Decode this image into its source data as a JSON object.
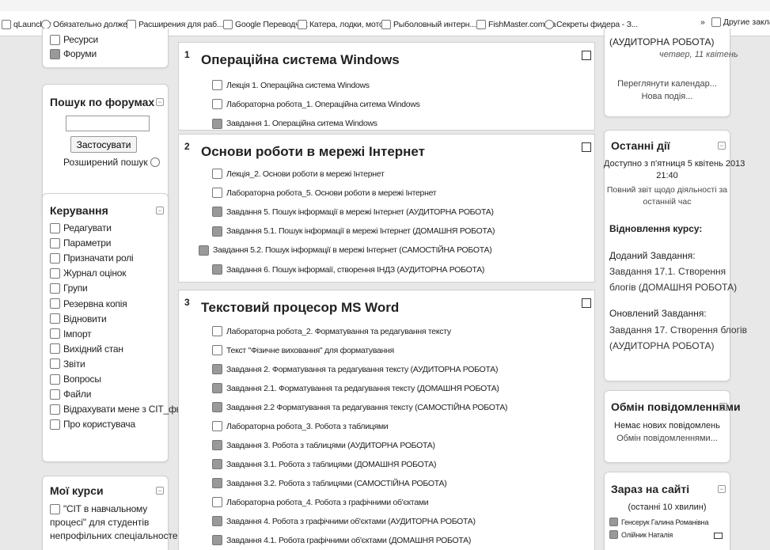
{
  "bookmarks": [
    {
      "label": "qLauncher",
      "icon": "folder-icon"
    },
    {
      "label": "Обязательно долже...",
      "icon": "drop-icon"
    },
    {
      "label": "Расширения для раб...",
      "icon": "puzzle-icon"
    },
    {
      "label": "Google Переводчик",
      "icon": "translate-icon"
    },
    {
      "label": "Катера, лодки, мото...",
      "icon": "page-icon"
    },
    {
      "label": "Рыболовный интерн...",
      "icon": "page-icon"
    },
    {
      "label": "FishMaster.com.ua",
      "icon": "grid-icon"
    },
    {
      "label": "Секреты фидера - З...",
      "icon": "globe-icon"
    }
  ],
  "bookmarks_more": "»",
  "bookmarks_other": "Другие закладки",
  "left": {
    "nav_items": [
      "Ресурси",
      "Форуми"
    ],
    "search": {
      "title": "Пошук по форумах",
      "button": "Застосувати",
      "advanced": "Розширений пошук",
      "value": ""
    },
    "admin": {
      "title": "Керування",
      "items": [
        {
          "label": "Редагувати",
          "icon": "edit-icon"
        },
        {
          "label": "Параметри",
          "icon": "settings-icon"
        },
        {
          "label": "Призначати ролі",
          "icon": "roles-icon"
        },
        {
          "label": "Журнал оцінок",
          "icon": "grades-icon"
        },
        {
          "label": "Групи",
          "icon": "groups-icon"
        },
        {
          "label": "Резервна копія",
          "icon": "backup-icon"
        },
        {
          "label": "Відновити",
          "icon": "restore-icon"
        },
        {
          "label": "Імпорт",
          "icon": "import-icon"
        },
        {
          "label": "Вихідний стан",
          "icon": "reset-icon"
        },
        {
          "label": "Звіти",
          "icon": "reports-icon"
        },
        {
          "label": "Вопросы",
          "icon": "questions-icon"
        },
        {
          "label": "Файли",
          "icon": "files-icon"
        },
        {
          "label": "Відрахувати мене з СІТ_фв",
          "icon": "unenrol-icon"
        },
        {
          "label": "Про користувача",
          "icon": "profile-icon"
        }
      ]
    },
    "courses": {
      "title": "Мої курси",
      "text": [
        "\"СІТ в навчальному",
        "процесі\" для студентів",
        "непрофільних спеціальностей"
      ]
    }
  },
  "sections": [
    {
      "num": "1",
      "title": "Операційна система Windows",
      "items": [
        {
          "text": "Лекція 1. Операційна система Windows",
          "icon": "pdf-icon"
        },
        {
          "text": "Лабораторна робота_1. Операційна ситема Windows",
          "icon": "pdf-icon"
        },
        {
          "text": "Завдання 1. Операційна ситема Windows",
          "icon": "assignment-icon"
        }
      ]
    },
    {
      "num": "2",
      "title": "Основи роботи в мережі Інтернет",
      "items": [
        {
          "text": "Лекція_2. Основи роботи в мережі Інтернет",
          "icon": "pdf-icon"
        },
        {
          "text": "Лабораторна робота_5. Основи роботи в мережі Інтернет",
          "icon": "pdf-icon"
        },
        {
          "text": "Завдання 5. Пошук інформації в мережі Інтернет (АУДИТОРНА РОБОТА)",
          "icon": "assignment-icon"
        },
        {
          "text": "Завдання 5.1. Пошук інформації в мережі Інтернет (ДОМАШНЯ РОБОТА)",
          "icon": "assignment-icon"
        },
        {
          "text": "Завдання 5.2. Пошук інформації в мережі Інтернет (САМОСТІЙНА РОБОТА)",
          "icon": "assignment-icon"
        },
        {
          "text": "Завдання 6. Пошук інформаії, створення ІНДЗ (АУДИТОРНА РОБОТА)",
          "icon": "assignment-icon"
        }
      ]
    },
    {
      "num": "3",
      "title": "Текстовий процесор MS Word",
      "items": [
        {
          "text": "Лабораторна робота_2. Форматування та редагування тексту",
          "icon": "pdf-icon"
        },
        {
          "text": "Текст \"Фізичне виховання\" для форматування",
          "icon": "doc-icon"
        },
        {
          "text": "Завдання 2. Форматування та редагування тексту (АУДИТОРНА РОБОТА)",
          "icon": "assignment-icon"
        },
        {
          "text": "Завдання 2.1. Форматування та редагування тексту (ДОМАШНЯ РОБОТА)",
          "icon": "assignment-icon"
        },
        {
          "text": "Завдання 2.2 Форматування та редагування тексту (САМОСТІЙНА РОБОТА)",
          "icon": "assignment-icon"
        },
        {
          "text": "Лабораторна робота_3. Робота з таблицями",
          "icon": "pdf-icon"
        },
        {
          "text": "Завдання 3. Робота з таблицями (АУДИТОРНА РОБОТА)",
          "icon": "assignment-icon"
        },
        {
          "text": "Завдання 3.1. Робота з таблицями (ДОМАШНЯ РОБОТА)",
          "icon": "assignment-icon"
        },
        {
          "text": "Завдання 3.2. Робота з таблицями (САМОСТІЙНА РОБОТА)",
          "icon": "assignment-icon"
        },
        {
          "text": "Лабораторна робота_4. Робота з графічними об'єктами",
          "icon": "pdf-icon"
        },
        {
          "text": "Завдання 4. Робота з графічними об'єктами (АУДИТОРНА РОБОТА)",
          "icon": "assignment-icon"
        },
        {
          "text": "Завдання 4.1. Робота графічними об'єктами (ДОМАШНЯ РОБОТА)",
          "icon": "assignment-icon"
        }
      ]
    }
  ],
  "right": {
    "calendar": {
      "event": "(АУДИТОРНА РОБОТА)",
      "date": "четвер, 11 квітень",
      "link1": "Переглянути календар...",
      "link2": "Нова подія..."
    },
    "recent": {
      "title": "Останні дії",
      "since": [
        "Доступно з п'ятниця 5 квітень 2013",
        "21:40"
      ],
      "report": [
        "Повний звіт щодо діяльності за",
        "останній час"
      ],
      "updates_title": "Відновлення курсу:",
      "added_label": "Доданий Завдання:",
      "added_link": [
        "Завдання 17.1. Створення",
        "блогів (ДОМАШНЯ РОБОТА)"
      ],
      "updated_label": "Оновлений Завдання:",
      "updated_link": [
        "Завдання 17. Створення блогів",
        "(АУДИТОРНА РОБОТА)"
      ]
    },
    "messages": {
      "title": "Обмін повідомленнями",
      "none": "Немає нових повідомлень",
      "link": "Обмін повідомленнями..."
    },
    "online": {
      "title": "Зараз на сайті",
      "period": "(останні 10 хвилин)",
      "users": [
        "Генсерук Галина Романівна",
        "Олійник Наталія"
      ]
    }
  }
}
